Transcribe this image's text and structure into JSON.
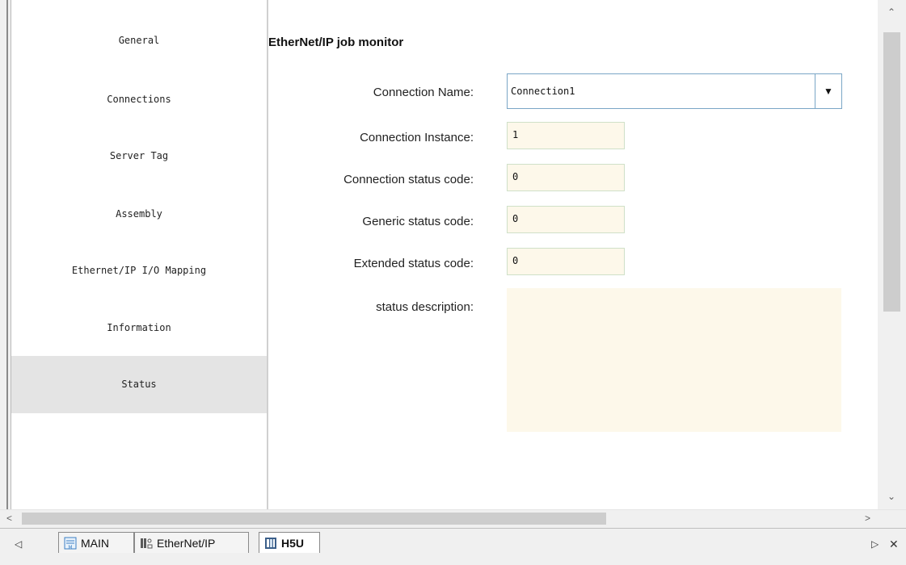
{
  "nav": {
    "items": [
      {
        "label": "General"
      },
      {
        "label": "Connections"
      },
      {
        "label": "Server Tag"
      },
      {
        "label": "Assembly"
      },
      {
        "label": "Ethernet/IP I/O Mapping"
      },
      {
        "label": "Information"
      },
      {
        "label": "Status",
        "selected": true
      }
    ]
  },
  "main": {
    "title": "EtherNet/IP job monitor",
    "connection_name_label": "Connection Name:",
    "connection_name_value": "Connection1",
    "connection_instance_label": "Connection Instance:",
    "connection_instance_value": "1",
    "connection_status_label": "Connection status code:",
    "connection_status_value": "0",
    "generic_status_label": "Generic status code:",
    "generic_status_value": "0",
    "extended_status_label": "Extended status code:",
    "extended_status_value": "0",
    "status_description_label": "status description:",
    "status_description_value": ""
  },
  "tabs": [
    {
      "label": "MAIN",
      "icon": "ladder-icon"
    },
    {
      "label": "EtherNet/IP",
      "icon": "network-icon"
    },
    {
      "label": "H5U",
      "icon": "plc-icon",
      "active": true
    }
  ],
  "colors": {
    "field_bg": "#fdf8ea",
    "selected_nav_bg": "#e4e4e4",
    "combo_border": "#7aa6c6"
  }
}
